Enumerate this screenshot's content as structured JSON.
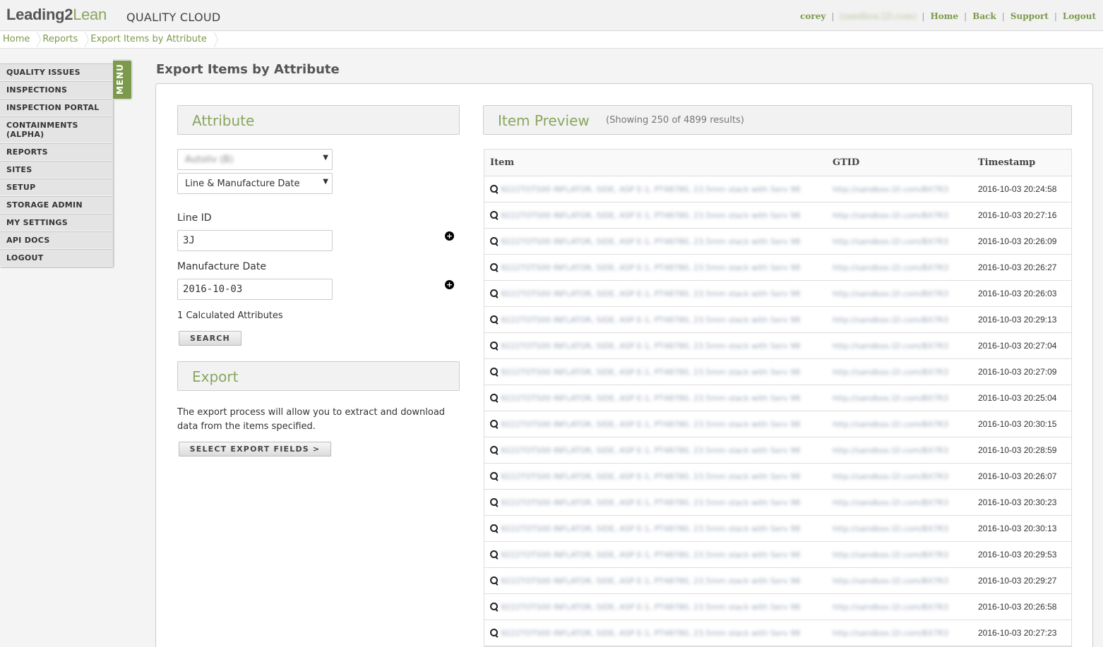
{
  "header": {
    "logo_part1": "Leading",
    "logo_part2": "2",
    "logo_part3": "Lean",
    "product": "QUALITY CLOUD",
    "user": "corey",
    "tenant": "(sandbox.l2l.com)",
    "links": {
      "home": "Home",
      "back": "Back",
      "support": "Support",
      "logout": "Logout"
    },
    "separator": "|"
  },
  "breadcrumb": [
    "Home",
    "Reports",
    "Export Items by Attribute"
  ],
  "menu": {
    "tab_label": "MENU",
    "items": [
      "QUALITY ISSUES",
      "INSPECTIONS",
      "INSPECTION PORTAL",
      "CONTAINMENTS (ALPHA)",
      "REPORTS",
      "SITES",
      "SETUP",
      "STORAGE ADMIN",
      "MY SETTINGS",
      "API DOCS",
      "LOGOUT"
    ]
  },
  "page_title": "Export Items by Attribute",
  "attribute": {
    "heading": "Attribute",
    "select1_value": "Autoliv (B)",
    "select2_value": "Line & Manufacture Date",
    "line_id_label": "Line ID",
    "line_id_value": "3J",
    "mfg_date_label": "Manufacture Date",
    "mfg_date_value": "2016-10-03",
    "calculated": "1 Calculated Attributes",
    "search_button": "SEARCH"
  },
  "export": {
    "heading": "Export",
    "description": "The export process will allow you to extract and download data from the items specified.",
    "button": "SELECT EXPORT FIELDS >"
  },
  "preview": {
    "heading": "Item Preview",
    "summary": "(Showing 250 of 4899 results)",
    "columns": [
      "Item",
      "GTID",
      "Timestamp"
    ],
    "blurred_item": "9222TOTS00 INFLATOR, SIDE, ASP E-1, PT48780, 23.5mm stack with Serv 98",
    "blurred_gtid": "http://sandbox.l2l.com/BX7R3",
    "rows": [
      {
        "ts": "2016-10-03 20:24:58"
      },
      {
        "ts": "2016-10-03 20:27:16"
      },
      {
        "ts": "2016-10-03 20:26:09"
      },
      {
        "ts": "2016-10-03 20:26:27"
      },
      {
        "ts": "2016-10-03 20:26:03"
      },
      {
        "ts": "2016-10-03 20:29:13"
      },
      {
        "ts": "2016-10-03 20:27:04"
      },
      {
        "ts": "2016-10-03 20:27:09"
      },
      {
        "ts": "2016-10-03 20:25:04"
      },
      {
        "ts": "2016-10-03 20:30:15"
      },
      {
        "ts": "2016-10-03 20:28:59"
      },
      {
        "ts": "2016-10-03 20:26:07"
      },
      {
        "ts": "2016-10-03 20:30:23"
      },
      {
        "ts": "2016-10-03 20:30:13"
      },
      {
        "ts": "2016-10-03 20:29:53"
      },
      {
        "ts": "2016-10-03 20:29:27"
      },
      {
        "ts": "2016-10-03 20:26:58"
      },
      {
        "ts": "2016-10-03 20:27:23"
      }
    ]
  },
  "colors": {
    "accent": "#8aa55e",
    "link": "#7c9a4c",
    "menu_tab": "#7c9a4c"
  }
}
